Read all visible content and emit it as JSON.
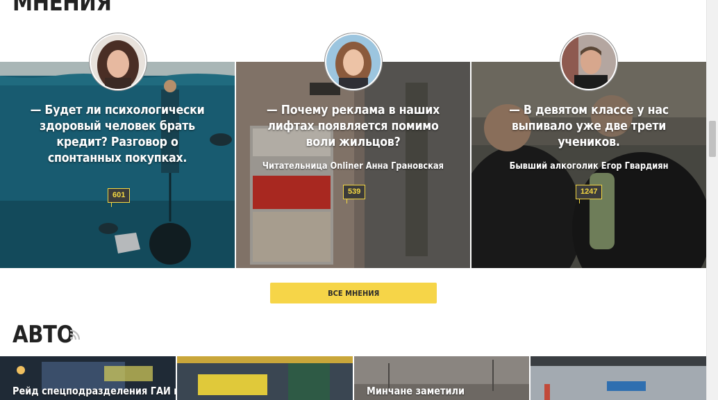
{
  "sections": {
    "opinions_title": "МНЕНИЯ",
    "auto_title": "АВТО"
  },
  "opinions": [
    {
      "quote": "— Будет ли психологически здоровый человек брать кредит? Разговор о спонтанных покупках.",
      "author": "",
      "comments": "601"
    },
    {
      "quote": "— Почему реклама в наших лифтах появляется помимо воли жильцов?",
      "author": "Читательница Onliner Анна Грановская",
      "comments": "539"
    },
    {
      "quote": "— В девятом классе у нас выпивало уже две трети учеников.",
      "author": "Бывший алкоголик Егор Гвардиян",
      "comments": "1247"
    }
  ],
  "all_opinions_button": "ВСЕ МНЕНИЯ",
  "auto": [
    {
      "title": "Рейд спецподразделения ГАИ на"
    },
    {
      "title": ""
    },
    {
      "title": "Минчане заметили"
    },
    {
      "title": ""
    }
  ],
  "colors": {
    "accent": "#f6d548",
    "heading": "#222222",
    "badge_border": "#f5d842"
  },
  "icons": {
    "rss": "rss-icon",
    "comment": "comment-badge"
  }
}
